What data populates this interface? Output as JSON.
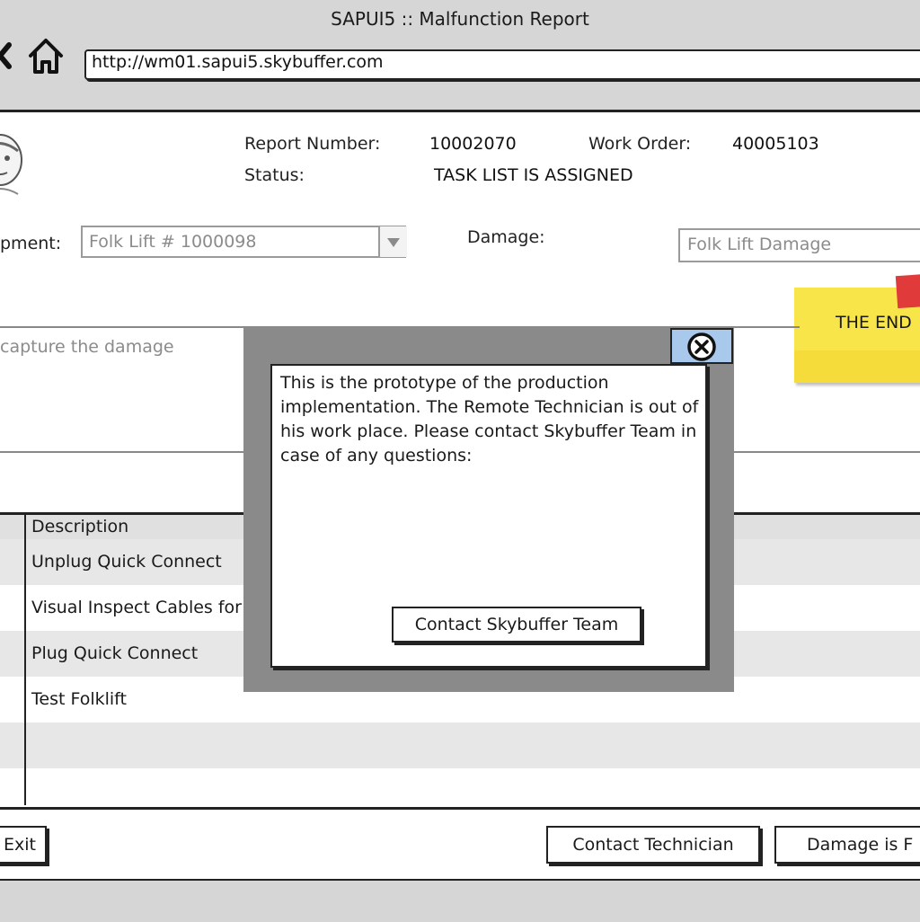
{
  "window": {
    "title": "SAPUI5 :: Malfunction Report"
  },
  "browser": {
    "url": "http://wm01.sapui5.skybuffer.com"
  },
  "header": {
    "report_number_label": "Report Number:",
    "report_number": "10002070",
    "work_order_label": "Work Order:",
    "work_order": "40005103",
    "status_label": "Status:",
    "status": "TASK LIST IS ASSIGNED"
  },
  "form": {
    "equipment_label": "pment:",
    "equipment_value": "Folk Lift # 1000098",
    "damage_label": "Damage:",
    "damage_value": "Folk Lift Damage",
    "textarea_placeholder": "capture the damage"
  },
  "sticky_note": {
    "text": "THE END"
  },
  "table": {
    "header": "Description",
    "rows": [
      "Unplug Quick Connect",
      "Visual Inspect Cables for",
      "Plug Quick Connect",
      "Test Folklift",
      "",
      ""
    ]
  },
  "footer": {
    "exit": "Exit",
    "contact_technician": "Contact Technician",
    "damage_fixed": "Damage is F"
  },
  "modal": {
    "message": "This is the prototype of the production implementation. The Remote Technician is out of his work place. Please contact Skybuffer Team in case of any questions:",
    "contact_button": "Contact Skybuffer Team"
  },
  "colors": {
    "chrome": "#d6d6d6",
    "overlay": "#8a8a8a",
    "sticky": "#f8e54a",
    "close_button": "#a9c9ec"
  }
}
